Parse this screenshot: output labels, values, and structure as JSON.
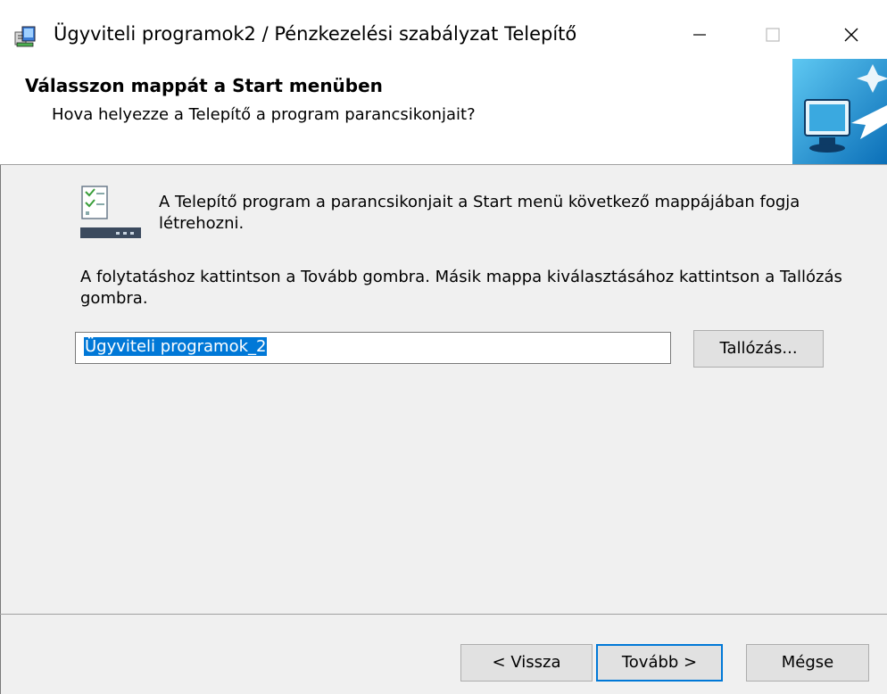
{
  "window": {
    "title": "Ügyviteli programok2 / Pénzkezelési szabályzat Telepítő"
  },
  "header": {
    "title": "Válasszon mappát a Start menüben",
    "subtitle": "Hova helyezze a Telepítő a program parancsikonjait?"
  },
  "content": {
    "intro": "A Telepítő program a parancsikonjait a Start menü következő mappájában fogja létrehozni.",
    "instruction": "A folytatáshoz kattintson a Tovább gombra. Másik mappa kiválasztásához kattintson a Tallózás gombra.",
    "folder_value": "Ügyviteli programok_2",
    "browse_label": "Tallózás..."
  },
  "footer": {
    "back_label": "< Vissza",
    "next_label": "Tovább >",
    "cancel_label": "Mégse"
  },
  "colors": {
    "accent": "#0078d7",
    "background": "#f0f0f0"
  }
}
